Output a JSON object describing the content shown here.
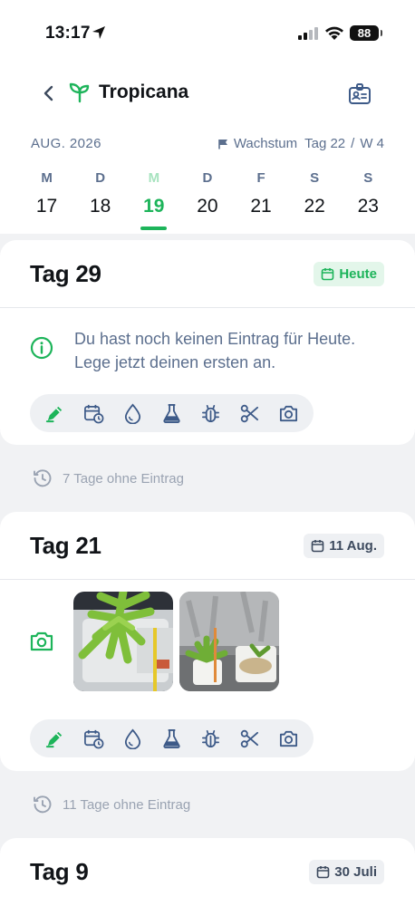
{
  "status": {
    "time": "13:17",
    "battery": "88"
  },
  "header": {
    "title": "Tropicana"
  },
  "calendar": {
    "month": "AUG. 2026",
    "phase": "Wachstum",
    "day_label": "Tag 22",
    "week_label": "W 4",
    "separator": "/",
    "days": [
      {
        "letter": "M",
        "num": "17"
      },
      {
        "letter": "D",
        "num": "18"
      },
      {
        "letter": "M",
        "num": "19"
      },
      {
        "letter": "D",
        "num": "20"
      },
      {
        "letter": "F",
        "num": "21"
      },
      {
        "letter": "S",
        "num": "22"
      },
      {
        "letter": "S",
        "num": "23"
      }
    ],
    "selected_index": 2
  },
  "entries": [
    {
      "title": "Tag 29",
      "badge": "Heute",
      "info": "Du hast noch keinen Eintrag für Heute. Lege jetzt deinen ersten an."
    },
    {
      "title": "Tag 21",
      "badge": "11 Aug."
    },
    {
      "title": "Tag 9",
      "badge": "30 Juli"
    }
  ],
  "gaps": [
    {
      "text": "7 Tage ohne Eintrag"
    },
    {
      "text": "11 Tage ohne Eintrag"
    }
  ],
  "toolbar_icons": [
    "edit-icon",
    "calendar-refresh-icon",
    "water-drop-icon",
    "flask-icon",
    "bug-icon",
    "scissors-icon",
    "camera-icon"
  ],
  "colors": {
    "accent": "#1db45a",
    "muted": "#5c6f8e",
    "background": "#f1f2f4"
  }
}
